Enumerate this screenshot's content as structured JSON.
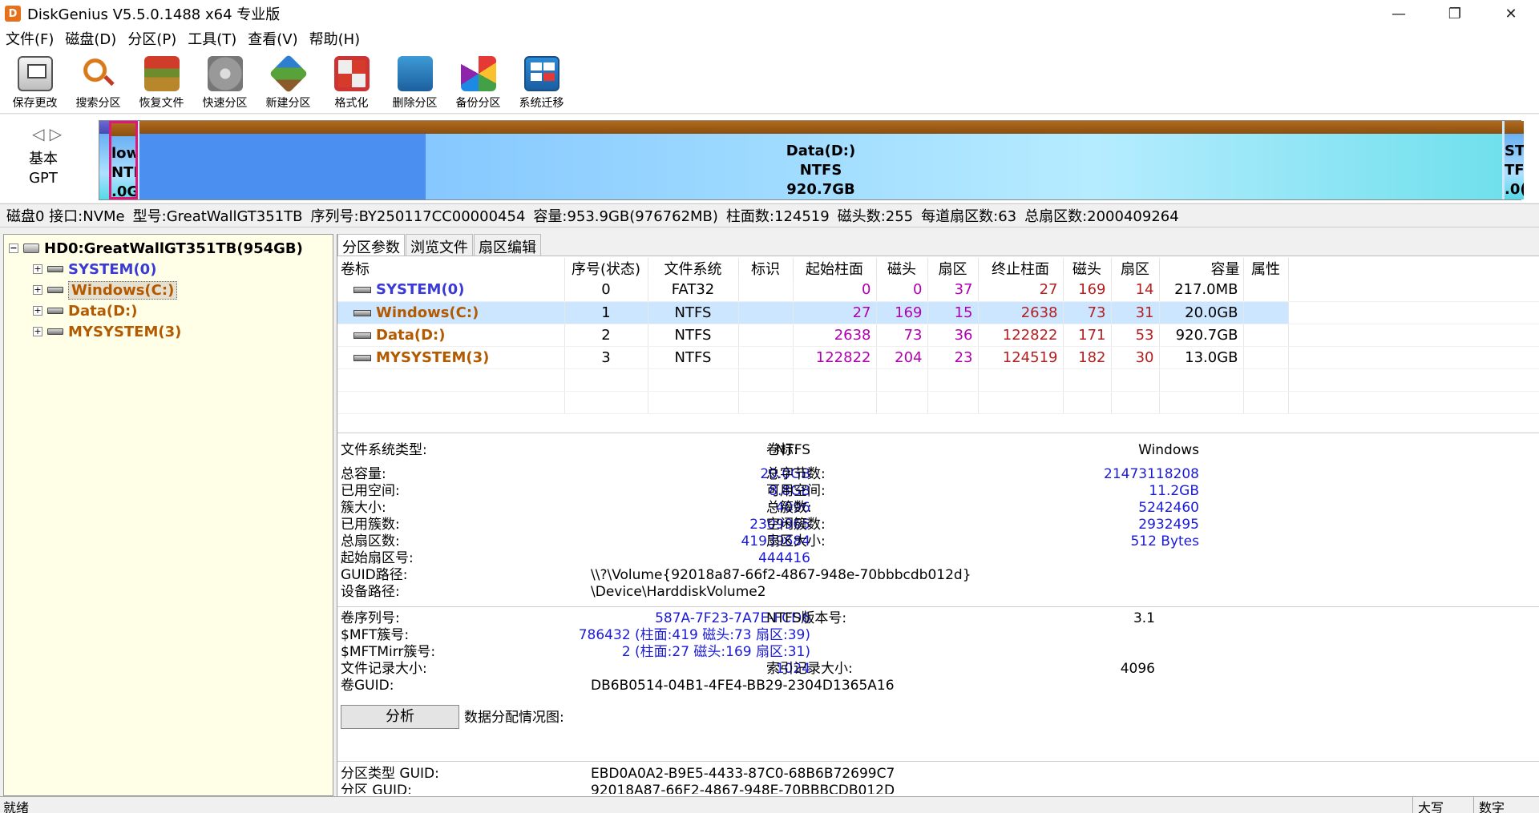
{
  "window": {
    "title": "DiskGenius V5.5.0.1488 x64 专业版",
    "minimize": "—",
    "restore": "❐",
    "close": "✕"
  },
  "menu": [
    "文件(F)",
    "磁盘(D)",
    "分区(P)",
    "工具(T)",
    "查看(V)",
    "帮助(H)"
  ],
  "toolbar": [
    {
      "label": "保存更改",
      "icon": "save-icon"
    },
    {
      "label": "搜索分区",
      "icon": "search-icon"
    },
    {
      "label": "恢复文件",
      "icon": "recover-icon"
    },
    {
      "label": "快速分区",
      "icon": "quick-partition-icon"
    },
    {
      "label": "新建分区",
      "icon": "new-partition-icon"
    },
    {
      "label": "格式化",
      "icon": "format-icon"
    },
    {
      "label": "删除分区",
      "icon": "delete-icon"
    },
    {
      "label": "备份分区",
      "icon": "backup-icon"
    },
    {
      "label": "系统迁移",
      "icon": "migrate-icon"
    }
  ],
  "diskmap": {
    "kind_line1": "基本",
    "kind_line2": "GPT",
    "nav": "◁ ▷",
    "win_seg": [
      "low",
      "NTF",
      ".0G"
    ],
    "data_seg": [
      "Data(D:)",
      "NTFS",
      "920.7GB"
    ],
    "my_seg": [
      "ST",
      "TF",
      ".0("
    ]
  },
  "diskinfo": {
    "disk": "磁盘0 接口:NVMe",
    "model": "型号:GreatWallGT351TB",
    "serial": "序列号:BY250117CC00000454",
    "capacity": "容量:953.9GB(976762MB)",
    "cylinders": "柱面数:124519",
    "heads": "磁头数:255",
    "sectors_per_track": "每道扇区数:63",
    "total_sectors": "总扇区数:2000409264"
  },
  "tree": {
    "root": "HD0:GreatWallGT351TB(954GB)",
    "children": [
      {
        "label": "SYSTEM(0)",
        "color": "blue"
      },
      {
        "label": "Windows(C:)",
        "color": "brown",
        "selected": true
      },
      {
        "label": "Data(D:)",
        "color": "brown"
      },
      {
        "label": "MYSYSTEM(3)",
        "color": "brown"
      }
    ]
  },
  "tabs": [
    "分区参数",
    "浏览文件",
    "扇区编辑"
  ],
  "table": {
    "headers": [
      "卷标",
      "序号(状态)",
      "文件系统",
      "标识",
      "起始柱面",
      "磁头",
      "扇区",
      "终止柱面",
      "磁头",
      "扇区",
      "容量",
      "属性"
    ],
    "rows": [
      {
        "label": "SYSTEM(0)",
        "color": "blue",
        "index": "0",
        "fs": "FAT32",
        "flag": "",
        "sc": "0",
        "sh": "0",
        "ss": "37",
        "ec": "27",
        "eh": "169",
        "es": "14",
        "size": "217.0MB",
        "attr": ""
      },
      {
        "label": "Windows(C:)",
        "color": "brown",
        "index": "1",
        "fs": "NTFS",
        "flag": "",
        "sc": "27",
        "sh": "169",
        "ss": "15",
        "ec": "2638",
        "eh": "73",
        "es": "31",
        "size": "20.0GB",
        "attr": ""
      },
      {
        "label": "Data(D:)",
        "color": "brown",
        "index": "2",
        "fs": "NTFS",
        "flag": "",
        "sc": "2638",
        "sh": "73",
        "ss": "36",
        "ec": "122822",
        "eh": "171",
        "es": "53",
        "size": "920.7GB",
        "attr": ""
      },
      {
        "label": "MYSYSTEM(3)",
        "color": "brown",
        "index": "3",
        "fs": "NTFS",
        "flag": "",
        "sc": "122822",
        "sh": "204",
        "ss": "23",
        "ec": "124519",
        "eh": "182",
        "es": "30",
        "size": "13.0GB",
        "attr": ""
      }
    ]
  },
  "details": {
    "fs_type_label": "文件系统类型:",
    "fs_type": "NTFS",
    "vol_label_label": "卷标:",
    "vol_label": "Windows",
    "total_label": "总容量:",
    "total": "20.0GB",
    "total_bytes_label": "总字节数:",
    "total_bytes": "21473118208",
    "used_label": "已用空间:",
    "used": "8.8GB",
    "free_label": "可用空间:",
    "free": "11.2GB",
    "cluster_label": "簇大小:",
    "cluster": "4096",
    "total_clusters_label": "总簇数:",
    "total_clusters": "5242460",
    "used_clusters_label": "已用簇数:",
    "used_clusters": "2309965",
    "free_clusters_label": "空闲簇数:",
    "free_clusters": "2932495",
    "total_sectors_label": "总扇区数:",
    "total_sectors": "41939684",
    "sector_size_label": "扇区大小:",
    "sector_size": "512 Bytes",
    "start_sector_label": "起始扇区号:",
    "start_sector": "444416",
    "guid_path_label": "GUID路径:",
    "guid_path": "\\\\?\\Volume{92018a87-66f2-4867-948e-70bbbcdb012d}",
    "device_path_label": "设备路径:",
    "device_path": "\\Device\\HarddiskVolume2",
    "serial_label": "卷序列号:",
    "serial": "587A-7F23-7A7E-FCD6",
    "ntfs_ver_label": "NTFS版本号:",
    "ntfs_ver": "3.1",
    "mft_label": "$MFT簇号:",
    "mft": "786432 (柱面:419 磁头:73 扇区:39)",
    "mftmirr_label": "$MFTMirr簇号:",
    "mftmirr": "2 (柱面:27 磁头:169 扇区:31)",
    "record_size_label": "文件记录大小:",
    "record_size": "1024",
    "index_size_label": "索引记录大小:",
    "index_size": "4096",
    "vol_guid_label": "卷GUID:",
    "vol_guid": "DB6B0514-04B1-4FE4-BB29-2304D1365A16",
    "analyze_button": "分析",
    "alloc_label": "数据分配情况图:",
    "ptype_guid_label": "分区类型 GUID:",
    "ptype_guid": "EBD0A0A2-B9E5-4433-87C0-68B6B72699C7",
    "part_guid_label": "分区 GUID:",
    "part_guid": "92018A87-66F2-4867-948E-70BBBCDB012D"
  },
  "status": {
    "left": "就绪",
    "caps": "大写",
    "num": "数字"
  }
}
